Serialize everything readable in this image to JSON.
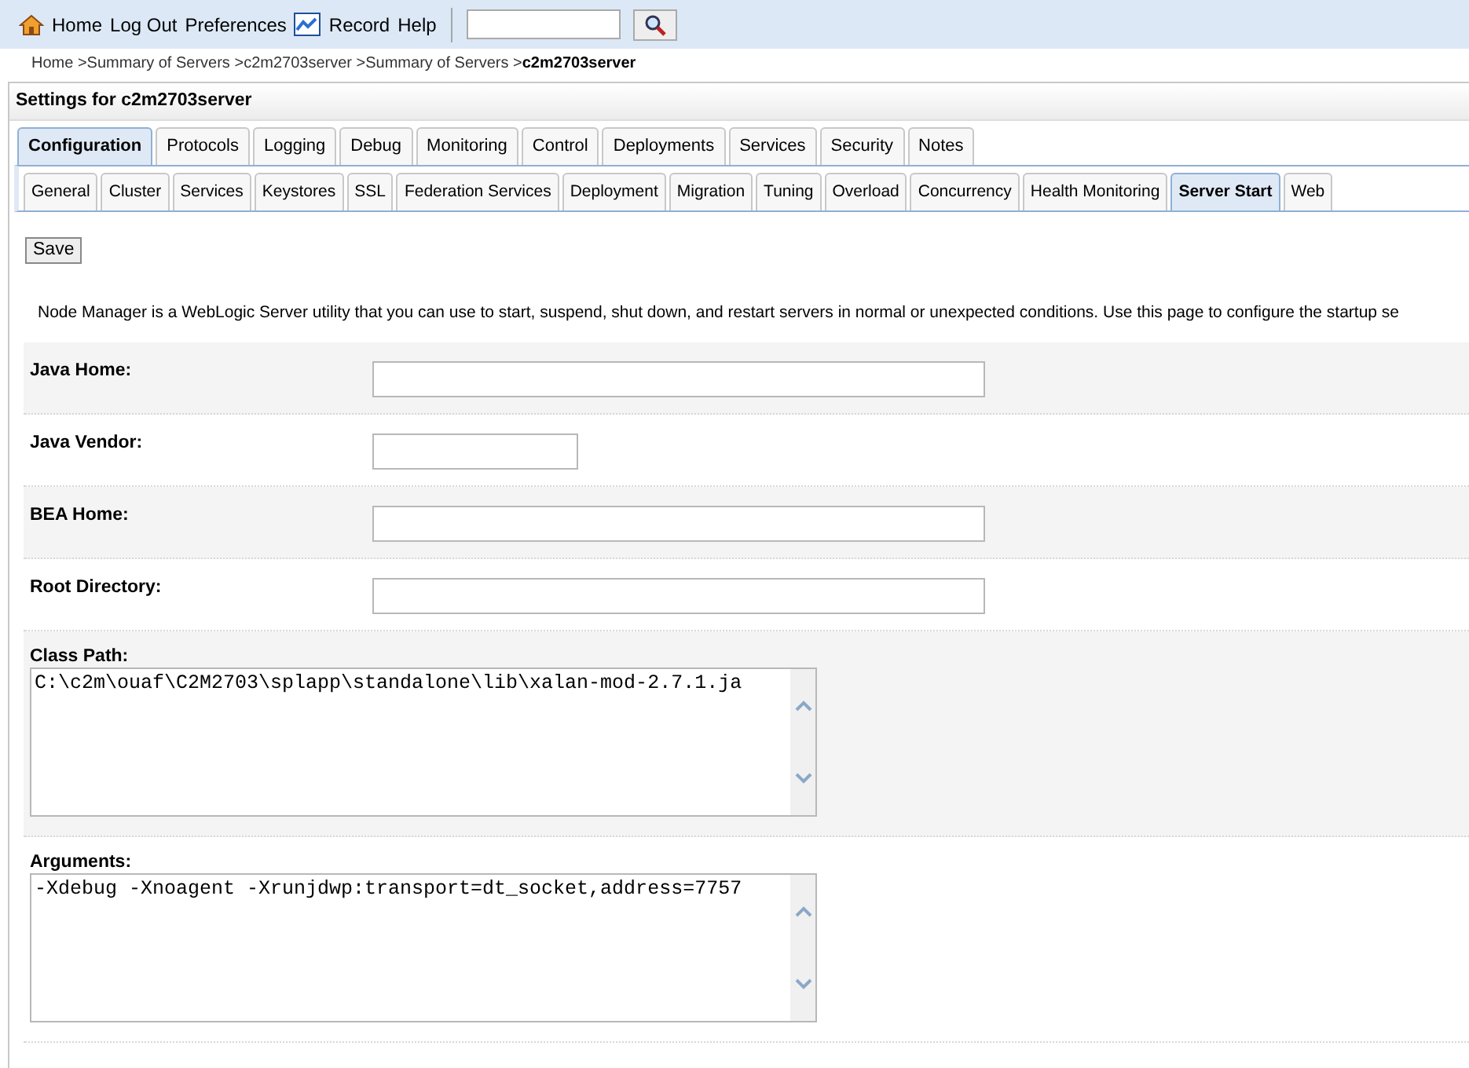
{
  "toolbar": {
    "links": [
      {
        "label": "Home"
      },
      {
        "label": "Log Out"
      },
      {
        "label": "Preferences"
      },
      {
        "label": "Record"
      },
      {
        "label": "Help"
      }
    ]
  },
  "breadcrumb": [
    {
      "label": "Home >",
      "current": false
    },
    {
      "label": "Summary of Servers >",
      "current": false
    },
    {
      "label": "c2m2703server >",
      "current": false
    },
    {
      "label": "Summary of Servers >",
      "current": false
    },
    {
      "label": "c2m2703server",
      "current": true
    }
  ],
  "panel_title": "Settings for c2m2703server",
  "tabs": [
    {
      "label": "Configuration",
      "selected": true
    },
    {
      "label": "Protocols",
      "selected": false
    },
    {
      "label": "Logging",
      "selected": false
    },
    {
      "label": "Debug",
      "selected": false
    },
    {
      "label": "Monitoring",
      "selected": false
    },
    {
      "label": "Control",
      "selected": false
    },
    {
      "label": "Deployments",
      "selected": false
    },
    {
      "label": "Services",
      "selected": false
    },
    {
      "label": "Security",
      "selected": false
    },
    {
      "label": "Notes",
      "selected": false
    }
  ],
  "subtabs": [
    {
      "label": "General",
      "selected": false
    },
    {
      "label": "Cluster",
      "selected": false
    },
    {
      "label": "Services",
      "selected": false
    },
    {
      "label": "Keystores",
      "selected": false
    },
    {
      "label": "SSL",
      "selected": false
    },
    {
      "label": "Federation Services",
      "selected": false
    },
    {
      "label": "Deployment",
      "selected": false
    },
    {
      "label": "Migration",
      "selected": false
    },
    {
      "label": "Tuning",
      "selected": false
    },
    {
      "label": "Overload",
      "selected": false
    },
    {
      "label": "Concurrency",
      "selected": false
    },
    {
      "label": "Health Monitoring",
      "selected": false
    },
    {
      "label": "Server Start",
      "selected": true
    },
    {
      "label": "Web",
      "selected": false
    }
  ],
  "save_button": "Save",
  "description": "Node Manager is a WebLogic Server utility that you can use to start, suspend, shut down, and restart servers in normal or unexpected conditions. Use this page to configure the startup se",
  "fields": [
    {
      "kind": "input",
      "label": "Java Home:"
    },
    {
      "kind": "short_input",
      "label": "Java Vendor:"
    },
    {
      "kind": "input",
      "label": "BEA Home:"
    },
    {
      "kind": "input",
      "label": "Root Directory:"
    },
    {
      "kind": "textarea",
      "label": "Class Path:",
      "value": "C:\\c2m\\ouaf\\C2M2703\\splapp\\standalone\\lib\\xalan-mod-2.7.1.ja"
    },
    {
      "kind": "textarea",
      "label": "Arguments:",
      "value": "-Xdebug -Xnoagent -Xrunjdwp:transport=dt_socket,address=7757"
    }
  ]
}
